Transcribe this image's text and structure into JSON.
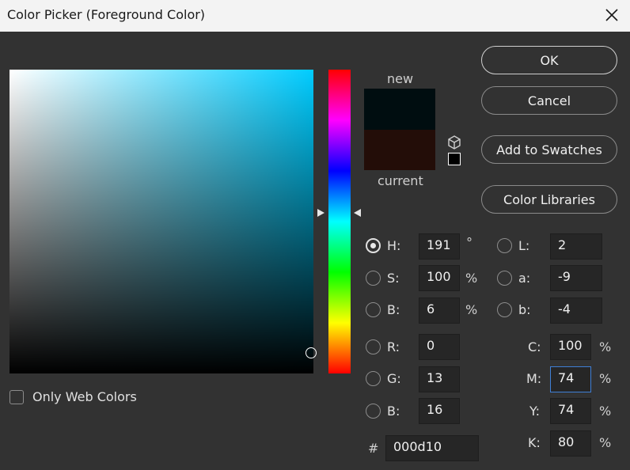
{
  "window": {
    "title": "Color Picker (Foreground Color)"
  },
  "swatch": {
    "new_label": "new",
    "current_label": "current",
    "new_color": "#000d10",
    "current_color": "#230d08"
  },
  "buttons": {
    "ok": "OK",
    "cancel": "Cancel",
    "add_to_swatches": "Add to Swatches",
    "color_libraries": "Color Libraries"
  },
  "hsb": {
    "h": {
      "label": "H:",
      "value": "191",
      "unit": "°",
      "selected": true
    },
    "s": {
      "label": "S:",
      "value": "100",
      "unit": "%"
    },
    "b": {
      "label": "B:",
      "value": "6",
      "unit": "%"
    }
  },
  "lab": {
    "l": {
      "label": "L:",
      "value": "2"
    },
    "a": {
      "label": "a:",
      "value": "-9"
    },
    "b": {
      "label": "b:",
      "value": "-4"
    }
  },
  "rgb": {
    "r": {
      "label": "R:",
      "value": "0"
    },
    "g": {
      "label": "G:",
      "value": "13"
    },
    "b": {
      "label": "B:",
      "value": "16"
    }
  },
  "cmyk": {
    "c": {
      "label": "C:",
      "value": "100",
      "unit": "%"
    },
    "m": {
      "label": "M:",
      "value": "74",
      "unit": "%"
    },
    "y": {
      "label": "Y:",
      "value": "74",
      "unit": "%"
    },
    "k": {
      "label": "K:",
      "value": "80",
      "unit": "%"
    }
  },
  "hex": {
    "label": "#",
    "value": "000d10"
  },
  "options": {
    "only_web_colors": "Only Web Colors"
  },
  "icons": {
    "close": "close-icon",
    "gamut": "cube-icon",
    "websafe": "websafe-square-icon"
  },
  "colors": {
    "field_hue": "#00ccff",
    "dialog_bg": "#323232",
    "focus_border": "#3f7fd6"
  }
}
